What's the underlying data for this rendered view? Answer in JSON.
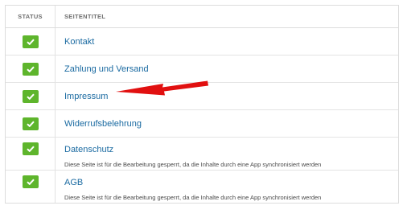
{
  "header": {
    "status_label": "STATUS",
    "title_label": "SEITENTITEL"
  },
  "rows": [
    {
      "title": "Kontakt",
      "status": "ok",
      "note": ""
    },
    {
      "title": "Zahlung und Versand",
      "status": "ok",
      "note": ""
    },
    {
      "title": "Impressum",
      "status": "ok",
      "note": ""
    },
    {
      "title": "Widerrufsbelehrung",
      "status": "ok",
      "note": ""
    },
    {
      "title": "Datenschutz",
      "status": "ok",
      "note": "Diese Seite ist für die Bearbeitung gesperrt, da die Inhalte durch eine App synchronisiert werden"
    },
    {
      "title": "AGB",
      "status": "ok",
      "note": "Diese Seite ist für die Bearbeitung gesperrt, da die Inhalte durch eine App synchronisiert werden"
    }
  ],
  "icons": {
    "status": "checkmark-icon",
    "annotation": "red-arrow"
  },
  "colors": {
    "status_ok": "#5eb52c",
    "link": "#1a6aa1",
    "annotation": "#e11010"
  }
}
